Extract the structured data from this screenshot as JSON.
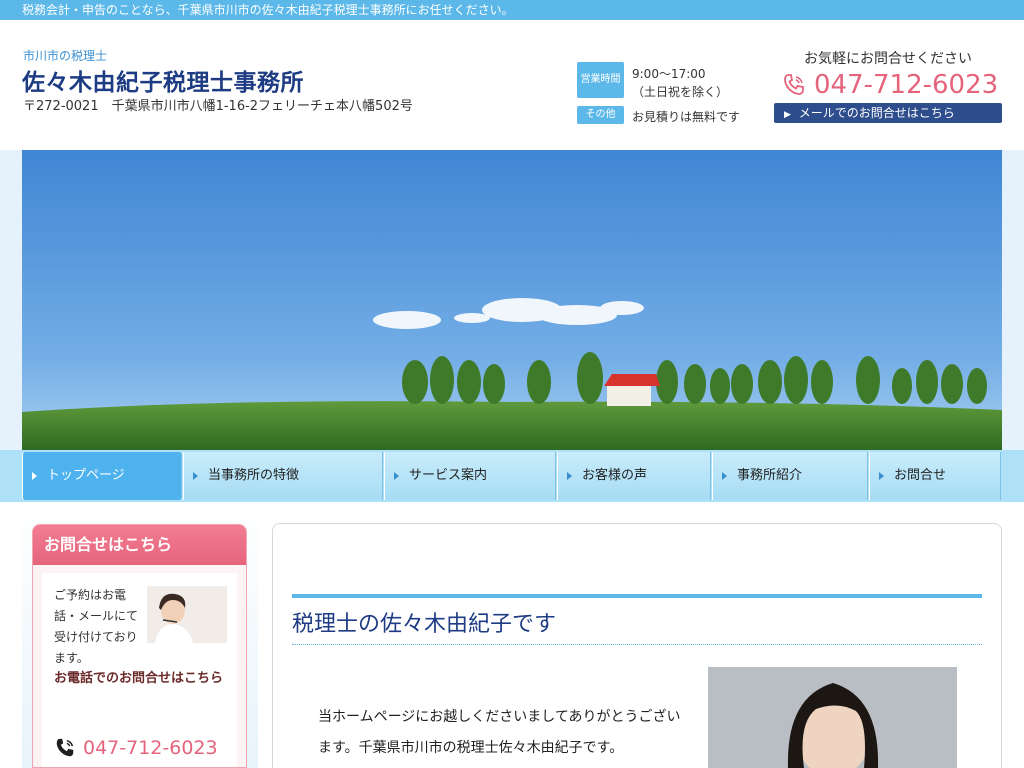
{
  "topbar": {
    "text": "税務会計・申告のことなら、千葉県市川市の佐々木由紀子税理士事務所にお任せください。"
  },
  "header": {
    "subtitle": "市川市の税理士",
    "title": "佐々木由紀子税理士事務所",
    "address": "〒272-0021　千葉県市川市八幡1-16-2フェリーチェ本八幡502号",
    "hours_badge": "営業時間",
    "hours_time": "9:00〜17:00",
    "hours_note": "（土日祝を除く）",
    "other_badge": "その他",
    "other_text": "お見積りは無料です",
    "contact_lead": "お気軽にお問合せください",
    "phone": "047-712-6023",
    "mail_button": "メールでのお問合せはこちら"
  },
  "nav": {
    "items": [
      {
        "label": "トップページ"
      },
      {
        "label": "当事務所の特徴"
      },
      {
        "label": "サービス案内"
      },
      {
        "label": "お客様の声"
      },
      {
        "label": "事務所紹介"
      },
      {
        "label": "お問合せ"
      }
    ]
  },
  "sidebar": {
    "heading": "お問合せはこちら",
    "text": "ご予約はお電話・メールにて受け付けております。",
    "tel_label": "お電話でのお問合せはこちら",
    "phone": "047-712-6023"
  },
  "main": {
    "title": "税理士の佐々木由紀子です",
    "text": "当ホームページにお越しくださいましてありがとうございます。千葉県市川市の税理士佐々木由紀子です。"
  },
  "colors": {
    "accent_blue": "#5bb8e8",
    "navy": "#1e3c84",
    "pink": "#e5647c"
  },
  "icons": [
    "phone-icon",
    "arrow-right-icon"
  ]
}
